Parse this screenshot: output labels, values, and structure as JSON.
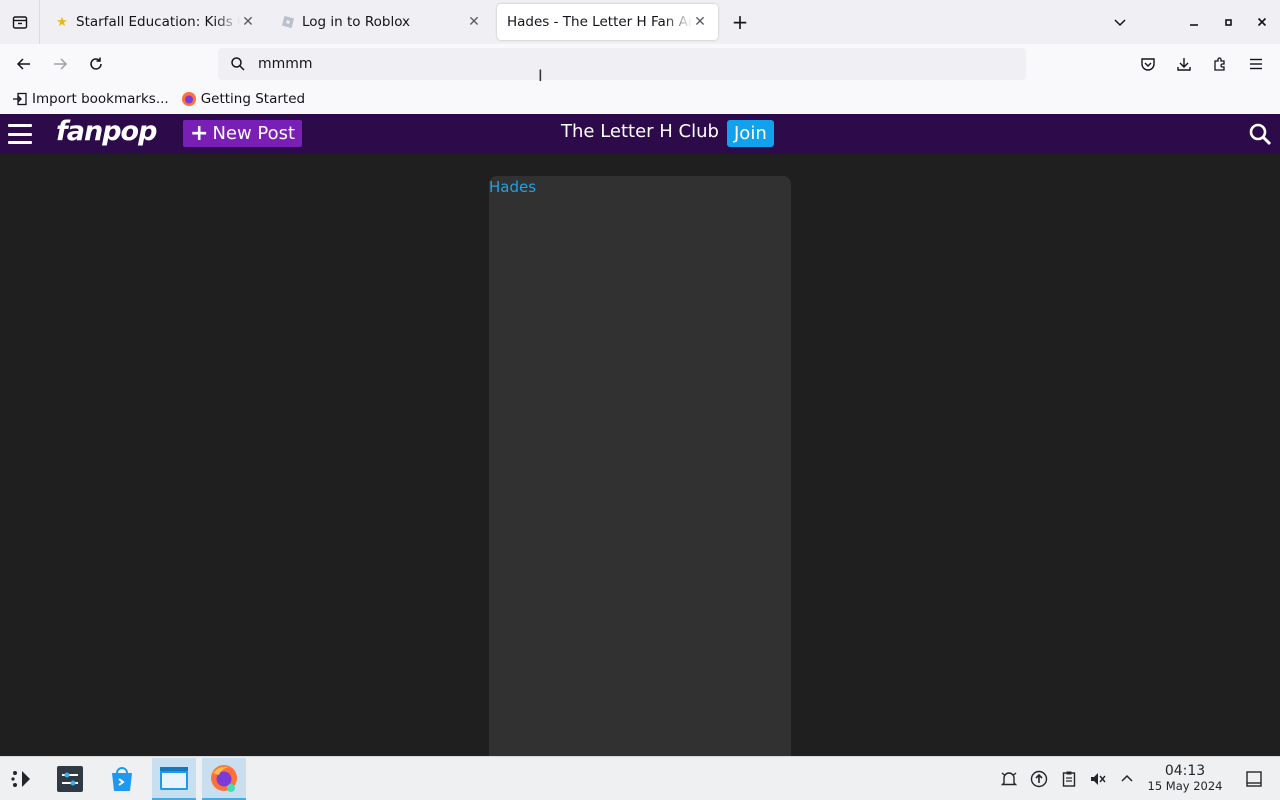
{
  "browser": {
    "tabs": [
      {
        "title": "Starfall Education: Kids Games",
        "favicon": "star-favicon"
      },
      {
        "title": "Log in to Roblox",
        "favicon": "roblox-favicon"
      },
      {
        "title": "Hades - The Letter H Fan Art",
        "favicon": "none",
        "active": true
      }
    ],
    "url": "mmmm",
    "bookmarks": [
      {
        "label": "Import bookmarks...",
        "icon": "import-icon"
      },
      {
        "label": "Getting Started",
        "icon": "firefox-icon"
      }
    ]
  },
  "fanpop": {
    "logo": "fanpop",
    "new_post": "New Post",
    "club_title": "The Letter H Club",
    "join": "Join",
    "card_link": "Hades"
  },
  "taskbar": {
    "time": "04:13",
    "date": "15 May 2024"
  },
  "colors": {
    "header_bg": "#2d0b4a",
    "new_post_bg": "#7a1fb5",
    "join_bg": "#12a2ed",
    "page_bg": "#1f1f1f",
    "card_bg": "#313131",
    "link": "#1ea2e6"
  }
}
